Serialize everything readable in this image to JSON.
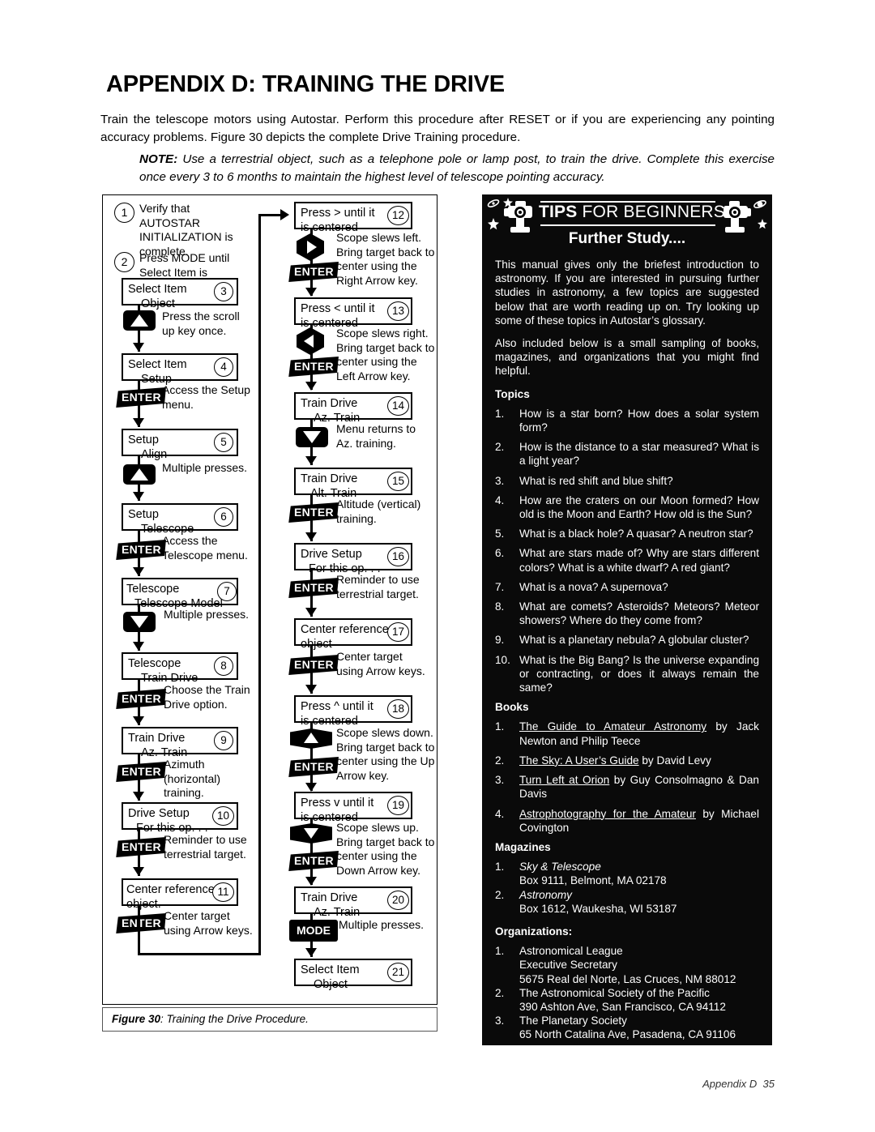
{
  "document": {
    "heading": "APPENDIX D: TRAINING THE DRIVE",
    "intro": "Train the telescope motors using Autostar. Perform this procedure after RESET or if you are experiencing any pointing accuracy problems. Figure 30 depicts the complete Drive Training procedure.",
    "note_label": "NOTE:",
    "note_text": " Use a terrestrial object, such as a telephone pole or lamp post, to train the drive. Complete this exercise once every 3 to 6 months to maintain the highest level of telescope pointing accuracy.",
    "footer_text": "Appendix D",
    "footer_page": "35"
  },
  "figure": {
    "caption_label": "Figure 30",
    "caption_text": ": Training the Drive Procedure."
  },
  "flow": {
    "step1": {
      "num": "1",
      "text": "Verify that AUTOSTAR INITIALIZATION is complete."
    },
    "step2": {
      "num": "2",
      "text": "Press MODE until Select Item is displayed."
    },
    "step3": {
      "num": "3",
      "line1": "Select Item",
      "line2": "Object",
      "anno": "Press the scroll up key once."
    },
    "step4": {
      "num": "4",
      "line1": "Select Item",
      "line2": "Setup",
      "anno": "Access the Setup menu.",
      "key": "ENTER"
    },
    "step5": {
      "num": "5",
      "line1": "Setup",
      "line2": "Align",
      "anno": "Multiple presses."
    },
    "step6": {
      "num": "6",
      "line1": "Setup",
      "line2": "Telescope",
      "anno": "Access the Telescope menu.",
      "key": "ENTER"
    },
    "step7": {
      "num": "7",
      "line1": "Telescope",
      "line2": "Telescope Model",
      "anno": "Multiple presses."
    },
    "step8": {
      "num": "8",
      "line1": "Telescope",
      "line2": "Train Drive",
      "anno": "Choose the Train Drive option.",
      "key": "ENTER"
    },
    "step9": {
      "num": "9",
      "line1": "Train Drive",
      "line2": "Az. Train",
      "anno": "Azimuth (horizontal) training.",
      "key": "ENTER"
    },
    "step10": {
      "num": "10",
      "line1": "Drive Setup",
      "line2": "For this op. . .",
      "anno": "Reminder to use terrestrial target.",
      "key": "ENTER"
    },
    "step11": {
      "num": "11",
      "line1": "Center reference",
      "line2": "object.",
      "anno": "Center target using Arrow keys.",
      "key": "ENTER"
    },
    "step12": {
      "num": "12",
      "line1": "Press  >  until it",
      "line2": "is centered",
      "anno": "Scope slews left. Bring target back to center using the Right Arrow key.",
      "key": "ENTER"
    },
    "step13": {
      "num": "13",
      "line1": "Press  <  until it",
      "line2": "is centered",
      "anno": "Scope slews right. Bring target back to center using the Left Arrow key.",
      "key": "ENTER"
    },
    "step14": {
      "num": "14",
      "line1": "Train Drive",
      "line2": "Az. Train",
      "anno": "Menu returns to Az. training."
    },
    "step15": {
      "num": "15",
      "line1": "Train Drive",
      "line2": "Alt. Train",
      "anno": "Altitude (vertical) training.",
      "key": "ENTER"
    },
    "step16": {
      "num": "16",
      "line1": "Drive Setup",
      "line2": "For this op. . .",
      "anno": "Reminder to use terrestrial target.",
      "key": "ENTER"
    },
    "step17": {
      "num": "17",
      "line1": "Center reference",
      "line2": "object",
      "anno": "Center target using Arrow keys.",
      "key": "ENTER"
    },
    "step18": {
      "num": "18",
      "line1": "Press  ^  until it",
      "line2": "is centered",
      "anno": "Scope slews down. Bring target back to center using the Up Arrow key.",
      "key": "ENTER"
    },
    "step19": {
      "num": "19",
      "line1": "Press  v  until it",
      "line2": "is centered",
      "anno": "Scope slews up. Bring target back to center using the Down Arrow key.",
      "key": "ENTER"
    },
    "step20": {
      "num": "20",
      "line1": "Train Drive",
      "line2": "Az. Train",
      "anno": "Multiple presses.",
      "key": "MODE"
    },
    "step21": {
      "num": "21",
      "line1": "Select Item",
      "line2": "Object"
    }
  },
  "tips": {
    "title_bold": "TIPS",
    "title_rest": " FOR BEGINNERS",
    "subtitle": "Further Study....",
    "para1": "This manual gives only the briefest introduction to astronomy. If you are interested in pursuing further studies in astronomy, a few topics are suggested below that are worth reading up on. Try looking up some of these topics in Autostar’s glossary.",
    "para2": "Also included below is a small sampling of books, magazines, and organizations that you might find helpful.",
    "topics_heading": "Topics",
    "topics": [
      {
        "num": "1.",
        "text": "How is a star born? How does a solar system form?"
      },
      {
        "num": "2.",
        "text": "How is the distance to a star measured? What is a light year?"
      },
      {
        "num": "3.",
        "text": "What is red shift and blue shift?"
      },
      {
        "num": "4.",
        "text": "How are the craters on our Moon formed? How old is the Moon and Earth? How old is the Sun?"
      },
      {
        "num": "5.",
        "text": "What is a black hole? A quasar? A neutron star?"
      },
      {
        "num": "6.",
        "text": "What are stars made of?  Why are stars different colors? What is a white dwarf?  A red giant?"
      },
      {
        "num": "7.",
        "text": "What is a nova? A supernova?"
      },
      {
        "num": "8.",
        "text": "What are comets? Asteroids? Meteors? Meteor showers? Where do they come from?"
      },
      {
        "num": "9.",
        "text": "What is a planetary nebula?  A globular cluster?"
      },
      {
        "num": "10.",
        "text": "What is the Big Bang?  Is the universe expanding or contracting, or does it always remain the same?"
      }
    ],
    "books_heading": "Books",
    "books": [
      {
        "num": "1.",
        "title": "The Guide to Amateur Astronomy",
        "rest": " by Jack Newton and Philip Teece"
      },
      {
        "num": "2.",
        "title": "The Sky: A User’s Guide",
        "rest": " by David Levy"
      },
      {
        "num": "3.",
        "title": "Turn Left at Orion",
        "rest": " by Guy Consolmagno & Dan Davis"
      },
      {
        "num": "4.",
        "title": "Astrophotography for the Amateur",
        "rest": " by Michael Covington"
      }
    ],
    "magazines_heading": "Magazines",
    "magazines": [
      {
        "num": "1.",
        "title": "Sky & Telescope",
        "address": "Box 9111, Belmont, MA 02178"
      },
      {
        "num": "2.",
        "title": "Astronomy",
        "address": "Box 1612, Waukesha, WI 53187"
      }
    ],
    "organizations_heading": "Organizations:",
    "organizations": [
      {
        "num": "1.",
        "line1": "Astronomical League",
        "line2": "Executive Secretary",
        "line3": "5675 Real del Norte, Las Cruces, NM 88012"
      },
      {
        "num": "2.",
        "line1": "The Astronomical Society of the Pacific",
        "line2": "390 Ashton Ave, San Francisco, CA 94112",
        "line3": ""
      },
      {
        "num": "3.",
        "line1": "The Planetary Society",
        "line2": "65 North Catalina Ave, Pasadena, CA 91106",
        "line3": ""
      }
    ]
  }
}
